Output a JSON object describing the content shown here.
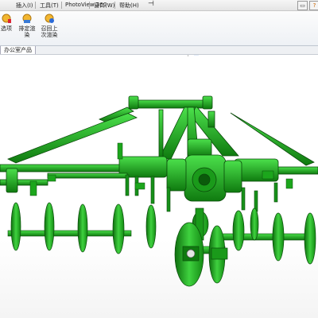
{
  "menu": {
    "items": [
      "插入",
      "工具",
      "PhotoView 360",
      "窗口",
      "帮助"
    ],
    "keys": [
      "(I)",
      "(T)",
      "",
      "(W)",
      "(H)"
    ],
    "pin": "⊣"
  },
  "ribbon": {
    "buttons": [
      {
        "label_1": "选项",
        "label_2": ""
      },
      {
        "label_1": "排定渲",
        "label_2": "染"
      },
      {
        "label_1": "召回上",
        "label_2": "次渲染"
      }
    ]
  },
  "tabs": [
    "办公室产品"
  ],
  "viewport": {
    "model_color": "#1aa31a",
    "background": "#ffffff"
  },
  "colors": {
    "accent": "#2a6ad8",
    "ribbon_bg": "#eef1f5"
  }
}
